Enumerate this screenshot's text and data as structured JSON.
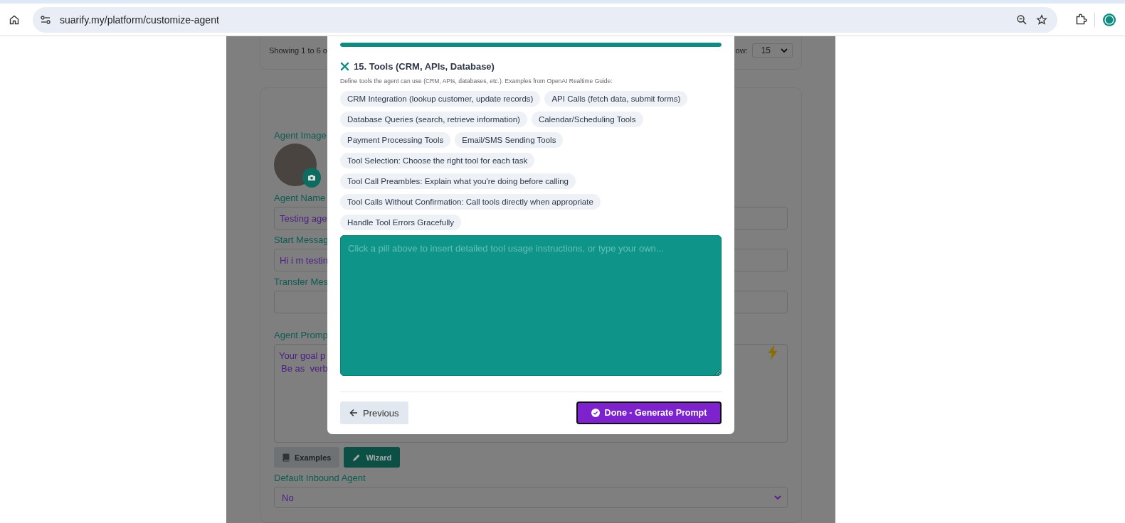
{
  "browser": {
    "url": "suarify.my/platform/customize-agent"
  },
  "background": {
    "list_footer": {
      "showing": "Showing 1 to 6 o",
      "show_label": "ow:",
      "per_page": "15"
    },
    "agent_image_label": "Agent Image",
    "fields": [
      {
        "label": "Agent Name",
        "value": "Testing age"
      },
      {
        "label": "Start Messag",
        "value": "Hi i m testin"
      },
      {
        "label": "Transfer Mes"
      }
    ],
    "agent_prompt": {
      "label": "Agent Promp",
      "lines": [
        "Your goal p",
        "Be as  verb"
      ]
    },
    "buttons": [
      {
        "label": "Examples",
        "kind": "examples"
      },
      {
        "label": "Wizard",
        "kind": "wizard"
      }
    ],
    "default_inbound": {
      "label": "Default Inbound Agent",
      "value": "No"
    }
  },
  "modal": {
    "progress": {
      "level": 1.0
    },
    "title": "15. Tools (CRM, APIs, Database)",
    "description": "Define tools the agent can use (CRM, APIs, databases, etc.). Examples from OpenAI Realtime Guide:",
    "pills": [
      "CRM Integration (lookup customer, update records)",
      "API Calls (fetch data, submit forms)",
      "Database Queries (search, retrieve information)",
      "Calendar/Scheduling Tools",
      "Payment Processing Tools",
      "Email/SMS Sending Tools",
      "Tool Selection: Choose the right tool for each task",
      "Tool Call Preambles: Explain what you're doing before calling",
      "Tool Calls Without Confirmation: Call tools directly when appropriate",
      "Handle Tool Errors Gracefully"
    ],
    "textarea": {
      "placeholder": "Click a pill above to insert detailed tool usage instructions, or type your own..."
    },
    "previous": "Previous",
    "done": "Done - Generate Prompt"
  }
}
